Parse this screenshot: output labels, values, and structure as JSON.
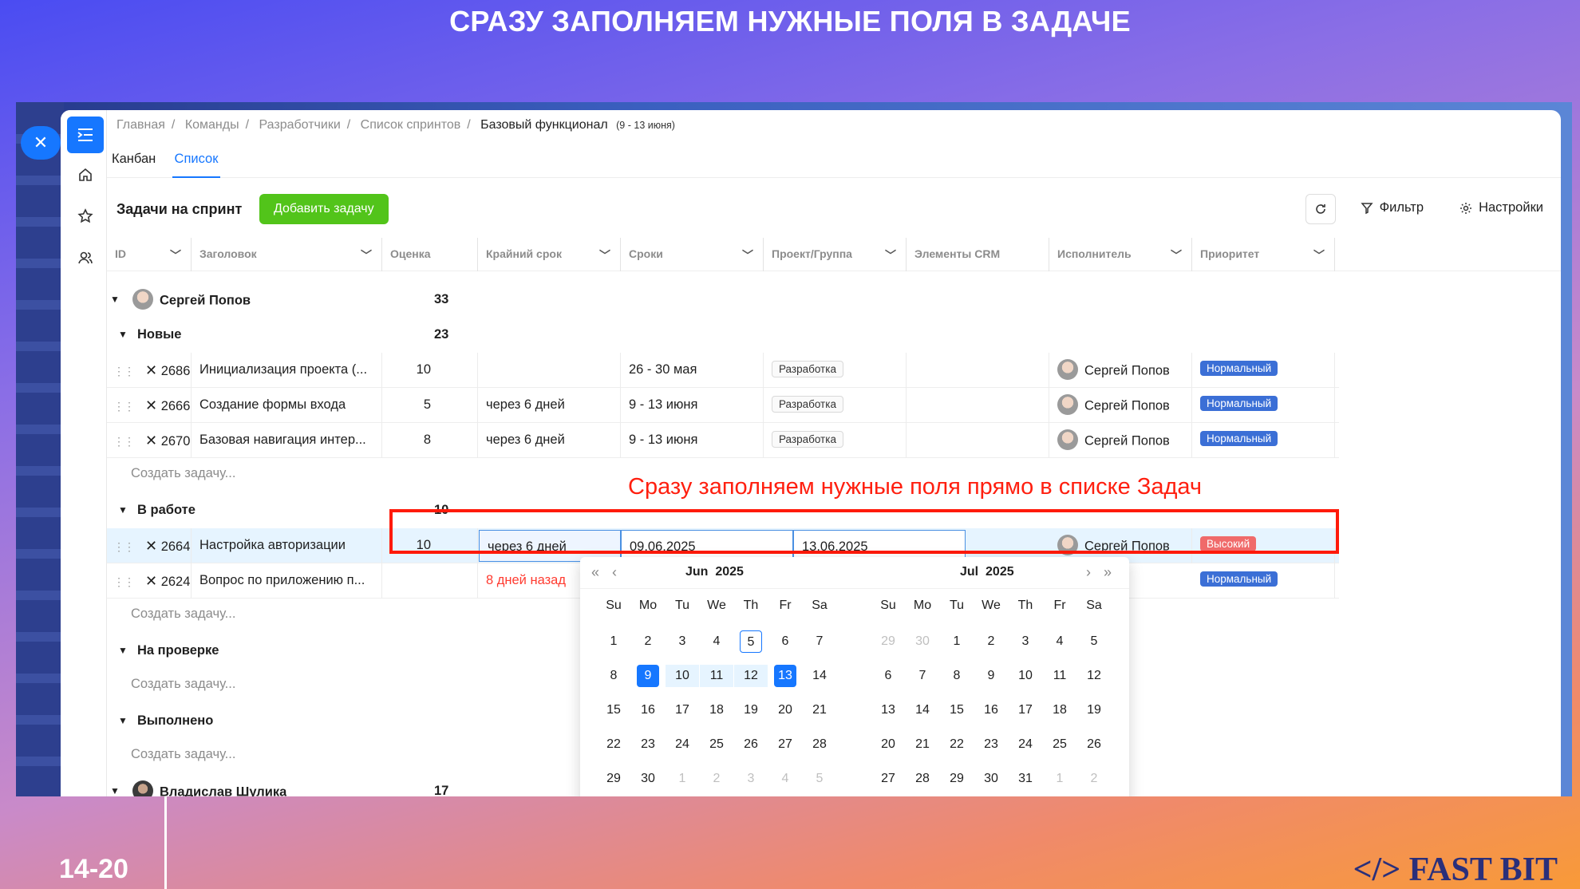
{
  "slide": {
    "title": "СРАЗУ ЗАПОЛНЯЕМ НУЖНЫЕ ПОЛЯ В ЗАДАЧЕ",
    "page": "14-20",
    "brand": "</> FAST BIT"
  },
  "breadcrumb": {
    "items": [
      "Главная",
      "Команды",
      "Разработчики",
      "Список спринтов"
    ],
    "current": "Базовый функционал",
    "current_sub": "(9 - 13 июня)"
  },
  "tabs": [
    {
      "label": "Канбан"
    },
    {
      "label": "Список"
    }
  ],
  "toolbar": {
    "title": "Задачи на спринт",
    "add_label": "Добавить задачу",
    "filter_label": "Фильтр",
    "settings_label": "Настройки"
  },
  "columns": [
    "ID",
    "Заголовок",
    "Оценка",
    "Крайний срок",
    "Сроки",
    "Проект/Группа",
    "Элементы CRM",
    "Исполнитель",
    "Приоритет"
  ],
  "groups": {
    "user1": {
      "name": "Сергей Попов",
      "score": "33"
    },
    "new": {
      "name": "Новые",
      "score": "23"
    },
    "work": {
      "name": "В работе",
      "score": "10"
    },
    "review": {
      "name": "На проверке"
    },
    "done": {
      "name": "Выполнено"
    },
    "user2": {
      "name": "Владислав Шулика",
      "score": "17"
    }
  },
  "tasks": [
    {
      "id": "2686",
      "title": "Инициализация проекта (...",
      "score": "10",
      "deadline": "",
      "dates": "26 - 30 мая",
      "project": "Разработка",
      "assignee": "Сергей Попов",
      "priority": "Нормальный"
    },
    {
      "id": "2666",
      "title": "Создание формы входа",
      "score": "5",
      "deadline": "через 6 дней",
      "dates": "9 - 13 июня",
      "project": "Разработка",
      "assignee": "Сергей Попов",
      "priority": "Нормальный"
    },
    {
      "id": "2670",
      "title": "Базовая навигация интер...",
      "score": "8",
      "deadline": "через 6 дней",
      "dates": "9 - 13 июня",
      "project": "Разработка",
      "assignee": "Сергей Попов",
      "priority": "Нормальный"
    },
    {
      "id": "2664",
      "title": "Настройка авторизации",
      "score": "10",
      "deadline": "через 6 дней",
      "date_start": "09.06.2025",
      "date_end": "13.06.2025",
      "assignee": "Сергей Попов",
      "priority": "Высокий"
    },
    {
      "id": "2624",
      "title": "Вопрос по приложению п...",
      "deadline": "8 дней назад",
      "priority": "Нормальный"
    }
  ],
  "create_task": "Создать задачу...",
  "annotation": "Сразу заполняем нужные поля прямо в списке Задач",
  "datepicker": {
    "weekdays": [
      "Su",
      "Mo",
      "Tu",
      "We",
      "Th",
      "Fr",
      "Sa"
    ],
    "months": [
      {
        "month": "Jun",
        "year": "2025",
        "weeks": [
          [
            "1",
            "2",
            "3",
            "4",
            "5",
            "6",
            "7"
          ],
          [
            "8",
            "9",
            "10",
            "11",
            "12",
            "13",
            "14"
          ],
          [
            "15",
            "16",
            "17",
            "18",
            "19",
            "20",
            "21"
          ],
          [
            "22",
            "23",
            "24",
            "25",
            "26",
            "27",
            "28"
          ],
          [
            "29",
            "30",
            "1",
            "2",
            "3",
            "4",
            "5"
          ]
        ]
      },
      {
        "month": "Jul",
        "year": "2025",
        "weeks": [
          [
            "29",
            "30",
            "1",
            "2",
            "3",
            "4",
            "5"
          ],
          [
            "6",
            "7",
            "8",
            "9",
            "10",
            "11",
            "12"
          ],
          [
            "13",
            "14",
            "15",
            "16",
            "17",
            "18",
            "19"
          ],
          [
            "20",
            "21",
            "22",
            "23",
            "24",
            "25",
            "26"
          ],
          [
            "27",
            "28",
            "29",
            "30",
            "31",
            "1",
            "2"
          ]
        ]
      }
    ]
  },
  "colors": {
    "primary": "#1677ff",
    "add_button": "#52c41a",
    "priority_normal": "#3b6fd6",
    "priority_high": "#f06a6a",
    "overdue": "#ff3b30",
    "annotation": "#ff1f0f"
  }
}
